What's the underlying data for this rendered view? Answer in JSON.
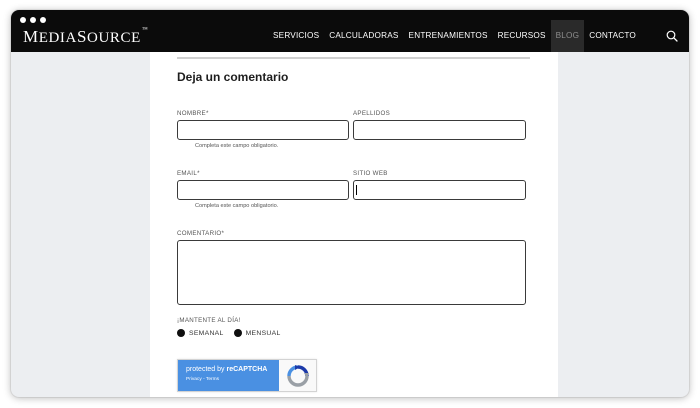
{
  "header": {
    "logo": "MEDIASOURCE",
    "logo_mark": "™",
    "nav": [
      {
        "label": "SERVICIOS"
      },
      {
        "label": "CALCULADORAS"
      },
      {
        "label": "ENTRENAMIENTOS"
      },
      {
        "label": "RECURSOS"
      },
      {
        "label": "BLOG"
      },
      {
        "label": "CONTACTO"
      }
    ],
    "active_nav": "BLOG",
    "search_icon": "search-icon"
  },
  "form": {
    "title": "Deja un comentario",
    "nombre": {
      "label": "NOMBRE*",
      "value": "",
      "hint": "Completa este campo obligatorio."
    },
    "apellidos": {
      "label": "APELLIDOS",
      "value": ""
    },
    "email": {
      "label": "EMAIL*",
      "value": "",
      "hint": "Completa este campo obligatorio."
    },
    "sitio_web": {
      "label": "SITIO WEB",
      "value": ""
    },
    "comentario": {
      "label": "COMENTARIO*",
      "value": ""
    },
    "newsletter": {
      "label": "¡MANTENTE AL DÍA!",
      "options": [
        {
          "label": "SEMANAL"
        },
        {
          "label": "MENSUAL"
        }
      ]
    },
    "recaptcha": {
      "protected_prefix": "protected by ",
      "brand": "reCAPTCHA",
      "privacy": "Privacy",
      "separator": " - ",
      "terms": "Terms"
    }
  },
  "colors": {
    "header_bg": "#0b0b0b",
    "page_bg": "#eceef1",
    "recaptcha_blue": "#4a90e2"
  }
}
